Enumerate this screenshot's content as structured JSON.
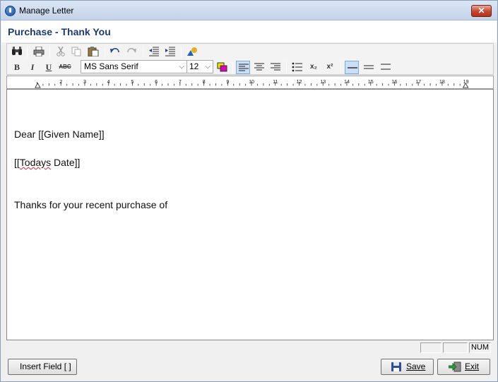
{
  "window": {
    "title": "Manage Letter",
    "close_glyph": "✕"
  },
  "header": {
    "title": "Purchase - Thank You"
  },
  "toolbar": {
    "font_name": "MS Sans Serif",
    "font_size": "12",
    "bold": "B",
    "italic": "I",
    "underline": "U",
    "strike": "ABC",
    "subscript": "x₂",
    "superscript": "x²"
  },
  "ruler": {
    "numbers": [
      "2",
      "3",
      "4",
      "5",
      "6",
      "7",
      "8",
      "9",
      "10",
      "11",
      "12",
      "13",
      "14",
      "15",
      "16",
      "17",
      "18",
      "19"
    ]
  },
  "document": {
    "line1": "Dear [[Given Name]]",
    "line2_prefix": "[[",
    "line2_misspelled": "Todays",
    "line2_suffix": " Date]]",
    "line3": "Thanks for your recent purchase of"
  },
  "status": {
    "num": "NUM"
  },
  "buttons": {
    "insert_field": "Insert Field [ ]",
    "save": "Save",
    "exit": "Exit"
  }
}
